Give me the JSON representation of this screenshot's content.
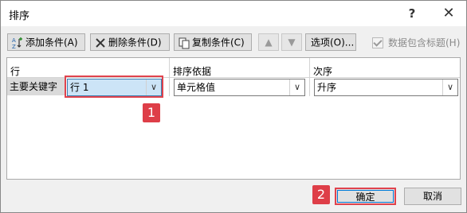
{
  "dialog": {
    "title": "排序",
    "help_glyph": "?",
    "close_glyph": "✕"
  },
  "toolbar": {
    "add_label": "添加条件(A)",
    "delete_label": "删除条件(D)",
    "copy_label": "复制条件(C)",
    "move_up_glyph": "▲",
    "move_down_glyph": "▼",
    "options_label": "选项(O)...",
    "header_checkbox_label": "数据包含标题(H)",
    "header_checkbox_checked": true
  },
  "grid": {
    "headers": {
      "column": "行",
      "basis": "排序依据",
      "order": "次序"
    },
    "rows": [
      {
        "label": "主要关键字",
        "key_value": "行 1",
        "basis_value": "单元格值",
        "order_value": "升序"
      }
    ],
    "dropdown_glyph": "∨"
  },
  "annotations": {
    "badge1": "1",
    "badge2": "2",
    "highlight_color": "#e0434d"
  },
  "buttons": {
    "ok_label": "确定",
    "cancel_label": "取消"
  }
}
